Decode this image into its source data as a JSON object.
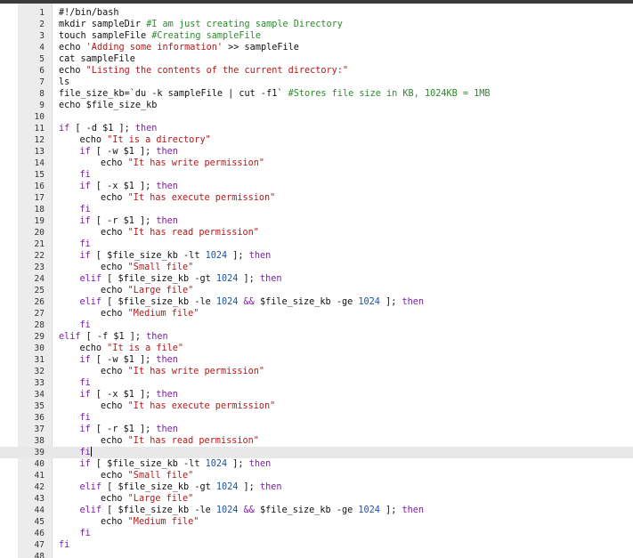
{
  "editor": {
    "active_line": 39,
    "colors": {
      "keyword": "#7a1fa2",
      "string": "#b11a1a",
      "comment": "#2d8a2d",
      "number": "#1a55a8",
      "plain": "#111111",
      "gutter": "#ececec"
    },
    "lines": [
      {
        "n": "1",
        "indent": 0,
        "tokens": [
          {
            "t": "pl",
            "v": "#!/bin/bash"
          }
        ]
      },
      {
        "n": "2",
        "indent": 0,
        "tokens": [
          {
            "t": "pl",
            "v": "mkdir sampleDir "
          },
          {
            "t": "cmt",
            "v": "#I am just creating sample Directory"
          }
        ]
      },
      {
        "n": "3",
        "indent": 0,
        "tokens": [
          {
            "t": "pl",
            "v": "touch sampleFile "
          },
          {
            "t": "cmt",
            "v": "#Creating sampleFile"
          }
        ]
      },
      {
        "n": "4",
        "indent": 0,
        "tokens": [
          {
            "t": "pl",
            "v": "echo "
          },
          {
            "t": "str",
            "v": "'Adding some information'"
          },
          {
            "t": "pl",
            "v": " >> sampleFile"
          }
        ]
      },
      {
        "n": "5",
        "indent": 0,
        "tokens": [
          {
            "t": "pl",
            "v": "cat sampleFile"
          }
        ]
      },
      {
        "n": "6",
        "indent": 0,
        "tokens": [
          {
            "t": "pl",
            "v": "echo "
          },
          {
            "t": "str",
            "v": "\"Listing the contents of the current directory:\""
          }
        ]
      },
      {
        "n": "7",
        "indent": 0,
        "tokens": [
          {
            "t": "pl",
            "v": "ls"
          }
        ]
      },
      {
        "n": "8",
        "indent": 0,
        "tokens": [
          {
            "t": "pl",
            "v": "file_size_kb=`du -k sampleFile | cut -f1` "
          },
          {
            "t": "cmt",
            "v": "#Stores file size in KB, 1024KB = 1MB"
          }
        ]
      },
      {
        "n": "9",
        "indent": 0,
        "tokens": [
          {
            "t": "pl",
            "v": "echo $file_size_kb"
          }
        ]
      },
      {
        "n": "10",
        "indent": 0,
        "tokens": []
      },
      {
        "n": "11",
        "indent": 0,
        "tokens": [
          {
            "t": "kw",
            "v": "if"
          },
          {
            "t": "pl",
            "v": " [ -d $1 ]; "
          },
          {
            "t": "kw",
            "v": "then"
          }
        ]
      },
      {
        "n": "12",
        "indent": 1,
        "tokens": [
          {
            "t": "pl",
            "v": "echo "
          },
          {
            "t": "str",
            "v": "\"It is a directory\""
          }
        ]
      },
      {
        "n": "13",
        "indent": 1,
        "tokens": [
          {
            "t": "kw",
            "v": "if"
          },
          {
            "t": "pl",
            "v": " [ -w $1 ]; "
          },
          {
            "t": "kw",
            "v": "then"
          }
        ]
      },
      {
        "n": "14",
        "indent": 2,
        "tokens": [
          {
            "t": "pl",
            "v": "echo "
          },
          {
            "t": "str",
            "v": "\"It has write permission\""
          }
        ]
      },
      {
        "n": "15",
        "indent": 1,
        "tokens": [
          {
            "t": "kw",
            "v": "fi"
          }
        ]
      },
      {
        "n": "16",
        "indent": 1,
        "tokens": [
          {
            "t": "kw",
            "v": "if"
          },
          {
            "t": "pl",
            "v": " [ -x $1 ]; "
          },
          {
            "t": "kw",
            "v": "then"
          }
        ]
      },
      {
        "n": "17",
        "indent": 2,
        "tokens": [
          {
            "t": "pl",
            "v": "echo "
          },
          {
            "t": "str",
            "v": "\"It has execute permission\""
          }
        ]
      },
      {
        "n": "18",
        "indent": 1,
        "tokens": [
          {
            "t": "kw",
            "v": "fi"
          }
        ]
      },
      {
        "n": "19",
        "indent": 1,
        "tokens": [
          {
            "t": "kw",
            "v": "if"
          },
          {
            "t": "pl",
            "v": " [ -r $1 ]; "
          },
          {
            "t": "kw",
            "v": "then"
          }
        ]
      },
      {
        "n": "20",
        "indent": 2,
        "tokens": [
          {
            "t": "pl",
            "v": "echo "
          },
          {
            "t": "str",
            "v": "\"It has read permission\""
          }
        ]
      },
      {
        "n": "21",
        "indent": 1,
        "tokens": [
          {
            "t": "kw",
            "v": "fi"
          }
        ]
      },
      {
        "n": "22",
        "indent": 1,
        "tokens": [
          {
            "t": "kw",
            "v": "if"
          },
          {
            "t": "pl",
            "v": " [ $file_size_kb -lt "
          },
          {
            "t": "num",
            "v": "1024"
          },
          {
            "t": "pl",
            "v": " ]; "
          },
          {
            "t": "kw",
            "v": "then"
          }
        ]
      },
      {
        "n": "23",
        "indent": 2,
        "tokens": [
          {
            "t": "pl",
            "v": "echo "
          },
          {
            "t": "str",
            "v": "\"Small file\""
          }
        ]
      },
      {
        "n": "24",
        "indent": 1,
        "tokens": [
          {
            "t": "kw",
            "v": "elif"
          },
          {
            "t": "pl",
            "v": " [ $file_size_kb -gt "
          },
          {
            "t": "num",
            "v": "1024"
          },
          {
            "t": "pl",
            "v": " ]; "
          },
          {
            "t": "kw",
            "v": "then"
          }
        ]
      },
      {
        "n": "25",
        "indent": 2,
        "tokens": [
          {
            "t": "pl",
            "v": "echo "
          },
          {
            "t": "str",
            "v": "\"Large file\""
          }
        ]
      },
      {
        "n": "26",
        "indent": 1,
        "tokens": [
          {
            "t": "kw",
            "v": "elif"
          },
          {
            "t": "pl",
            "v": " [ $file_size_kb -le "
          },
          {
            "t": "num",
            "v": "1024"
          },
          {
            "t": "pl",
            "v": " "
          },
          {
            "t": "kw",
            "v": "&&"
          },
          {
            "t": "pl",
            "v": " $file_size_kb -ge "
          },
          {
            "t": "num",
            "v": "1024"
          },
          {
            "t": "pl",
            "v": " ]; "
          },
          {
            "t": "kw",
            "v": "then"
          }
        ]
      },
      {
        "n": "27",
        "indent": 2,
        "tokens": [
          {
            "t": "pl",
            "v": "echo "
          },
          {
            "t": "str",
            "v": "\"Medium file\""
          }
        ]
      },
      {
        "n": "28",
        "indent": 1,
        "tokens": [
          {
            "t": "kw",
            "v": "fi"
          }
        ]
      },
      {
        "n": "29",
        "indent": 0,
        "tokens": [
          {
            "t": "kw",
            "v": "elif"
          },
          {
            "t": "pl",
            "v": " [ -f $1 ]; "
          },
          {
            "t": "kw",
            "v": "then"
          }
        ]
      },
      {
        "n": "30",
        "indent": 1,
        "tokens": [
          {
            "t": "pl",
            "v": "echo "
          },
          {
            "t": "str",
            "v": "\"It is a file\""
          }
        ]
      },
      {
        "n": "31",
        "indent": 1,
        "tokens": [
          {
            "t": "kw",
            "v": "if"
          },
          {
            "t": "pl",
            "v": " [ -w $1 ]; "
          },
          {
            "t": "kw",
            "v": "then"
          }
        ]
      },
      {
        "n": "32",
        "indent": 2,
        "tokens": [
          {
            "t": "pl",
            "v": "echo "
          },
          {
            "t": "str",
            "v": "\"It has write permission\""
          }
        ]
      },
      {
        "n": "33",
        "indent": 1,
        "tokens": [
          {
            "t": "kw",
            "v": "fi"
          }
        ]
      },
      {
        "n": "34",
        "indent": 1,
        "tokens": [
          {
            "t": "kw",
            "v": "if"
          },
          {
            "t": "pl",
            "v": " [ -x $1 ]; "
          },
          {
            "t": "kw",
            "v": "then"
          }
        ]
      },
      {
        "n": "35",
        "indent": 2,
        "tokens": [
          {
            "t": "pl",
            "v": "echo "
          },
          {
            "t": "str",
            "v": "\"It has execute permission\""
          }
        ]
      },
      {
        "n": "36",
        "indent": 1,
        "tokens": [
          {
            "t": "kw",
            "v": "fi"
          }
        ]
      },
      {
        "n": "37",
        "indent": 1,
        "tokens": [
          {
            "t": "kw",
            "v": "if"
          },
          {
            "t": "pl",
            "v": " [ -r $1 ]; "
          },
          {
            "t": "kw",
            "v": "then"
          }
        ]
      },
      {
        "n": "38",
        "indent": 2,
        "tokens": [
          {
            "t": "pl",
            "v": "echo "
          },
          {
            "t": "str",
            "v": "\"It has read permission\""
          }
        ]
      },
      {
        "n": "39",
        "indent": 1,
        "tokens": [
          {
            "t": "kw",
            "v": "fi"
          }
        ]
      },
      {
        "n": "40",
        "indent": 1,
        "tokens": [
          {
            "t": "kw",
            "v": "if"
          },
          {
            "t": "pl",
            "v": " [ $file_size_kb -lt "
          },
          {
            "t": "num",
            "v": "1024"
          },
          {
            "t": "pl",
            "v": " ]; "
          },
          {
            "t": "kw",
            "v": "then"
          }
        ]
      },
      {
        "n": "41",
        "indent": 2,
        "tokens": [
          {
            "t": "pl",
            "v": "echo "
          },
          {
            "t": "str",
            "v": "\"Small file\""
          }
        ]
      },
      {
        "n": "42",
        "indent": 1,
        "tokens": [
          {
            "t": "kw",
            "v": "elif"
          },
          {
            "t": "pl",
            "v": " [ $file_size_kb -gt "
          },
          {
            "t": "num",
            "v": "1024"
          },
          {
            "t": "pl",
            "v": " ]; "
          },
          {
            "t": "kw",
            "v": "then"
          }
        ]
      },
      {
        "n": "43",
        "indent": 2,
        "tokens": [
          {
            "t": "pl",
            "v": "echo "
          },
          {
            "t": "str",
            "v": "\"Large file\""
          }
        ]
      },
      {
        "n": "44",
        "indent": 1,
        "tokens": [
          {
            "t": "kw",
            "v": "elif"
          },
          {
            "t": "pl",
            "v": " [ $file_size_kb -le "
          },
          {
            "t": "num",
            "v": "1024"
          },
          {
            "t": "pl",
            "v": " "
          },
          {
            "t": "kw",
            "v": "&&"
          },
          {
            "t": "pl",
            "v": " $file_size_kb -ge "
          },
          {
            "t": "num",
            "v": "1024"
          },
          {
            "t": "pl",
            "v": " ]; "
          },
          {
            "t": "kw",
            "v": "then"
          }
        ]
      },
      {
        "n": "45",
        "indent": 2,
        "tokens": [
          {
            "t": "pl",
            "v": "echo "
          },
          {
            "t": "str",
            "v": "\"Medium file\""
          }
        ]
      },
      {
        "n": "46",
        "indent": 1,
        "tokens": [
          {
            "t": "kw",
            "v": "fi"
          }
        ]
      },
      {
        "n": "47",
        "indent": 0,
        "tokens": [
          {
            "t": "kw",
            "v": "fi"
          }
        ]
      },
      {
        "n": "48",
        "indent": 0,
        "tokens": []
      }
    ]
  }
}
